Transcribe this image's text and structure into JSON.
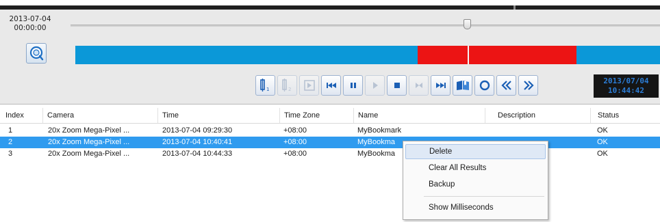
{
  "playback": {
    "start_date": "2013-07-04",
    "start_time": "00:00:00",
    "current_date": "2013/07/04",
    "current_time": "10:44:42",
    "timeline_colors": {
      "recording": "#0b98d8",
      "event": "#ec1414"
    },
    "controls": [
      {
        "name": "snapshot-cursor-icon",
        "disabled": false
      },
      {
        "name": "snapshot-cursor-alt-icon",
        "disabled": true
      },
      {
        "name": "frame-export-icon",
        "disabled": true
      },
      {
        "name": "skip-to-start-icon",
        "disabled": false
      },
      {
        "name": "pause-icon",
        "disabled": false
      },
      {
        "name": "play-icon",
        "disabled": true
      },
      {
        "name": "stop-icon",
        "disabled": false
      },
      {
        "name": "step-icon",
        "disabled": true
      },
      {
        "name": "skip-to-end-icon",
        "disabled": false
      },
      {
        "name": "bookmark-icon",
        "disabled": false
      },
      {
        "name": "refresh-icon",
        "disabled": false
      },
      {
        "name": "rewind-icon",
        "disabled": false
      },
      {
        "name": "fast-forward-icon",
        "disabled": false
      }
    ]
  },
  "table": {
    "columns": [
      "Index",
      "Camera",
      "Time",
      "Time Zone",
      "Name",
      "Description",
      "Status"
    ],
    "rows": [
      {
        "index": "1",
        "camera": "20x Zoom Mega-Pixel ...",
        "time": "2013-07-04 09:29:30",
        "zone": "+08:00",
        "name": "MyBookmark",
        "description": "",
        "status": "OK"
      },
      {
        "index": "2",
        "camera": "20x Zoom Mega-Pixel ...",
        "time": "2013-07-04 10:40:41",
        "zone": "+08:00",
        "name": "MyBookma",
        "description": "",
        "status": "OK"
      },
      {
        "index": "3",
        "camera": "20x Zoom Mega-Pixel ...",
        "time": "2013-07-04 10:44:33",
        "zone": "+08:00",
        "name": "MyBookma",
        "description": "",
        "status": "OK"
      }
    ],
    "selected_row": 1
  },
  "context_menu": {
    "items": [
      "Delete",
      "Clear All Results",
      "Backup",
      "Show Milliseconds"
    ]
  }
}
